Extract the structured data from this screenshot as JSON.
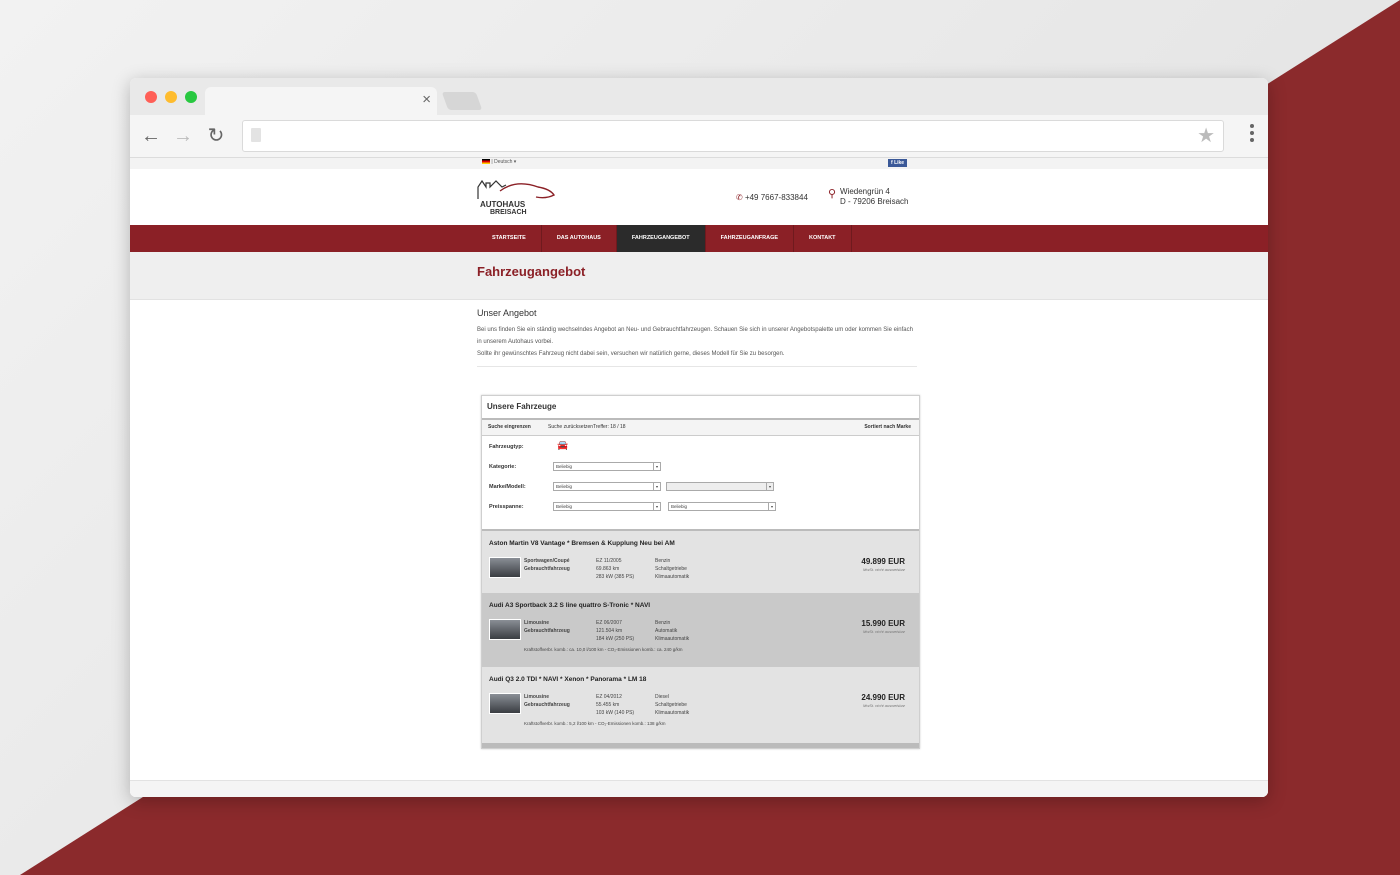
{
  "colors": {
    "brand": "#8b2026",
    "window_red": "#ff5f57",
    "window_yellow": "#febc2e",
    "window_green": "#28c840"
  },
  "browser": {
    "tab_close": "×",
    "back": "←",
    "forward": "→",
    "reload": "↻",
    "star": "★"
  },
  "site": {
    "language": "Deutsch",
    "facebook_like": "Like",
    "logo_text_1": "AUTOHAUS",
    "logo_text_2": "BREISACH",
    "phone": "+49 7667-833844",
    "address_line1": "Wiedengrün 4",
    "address_line2": "D - 79206 Breisach",
    "nav": [
      "STARTSEITE",
      "DAS AUTOHAUS",
      "FAHRZEUGANGEBOT",
      "FAHRZEUGANFRAGE",
      "KONTAKT"
    ],
    "page_title": "Fahrzeugangebot",
    "intro_heading": "Unser Angebot",
    "intro_p1": "Bei uns finden Sie ein ständig wechselndes Angebot an Neu- und Gebrauchtfahrzeugen. Schauen Sie sich in unserer Angebotspalette um oder kommen Sie einfach in unserem Autohaus vorbei.",
    "intro_p2": "Sollte ihr gewünschtes Fahrzeug nicht dabei sein, versuchen wir natürlich gerne, dieses Modell für Sie zu besorgen."
  },
  "widget": {
    "title": "Unsere Fahrzeuge",
    "bar_left": "Suche eingrenzen",
    "bar_mid": "Suche zurücksetzenTreffer: 18 / 18",
    "bar_right": "Sortiert nach Marke",
    "filter_type": "Fahrzeugtyp:",
    "filter_category": "Kategorie:",
    "filter_make": "Marke/Modell:",
    "filter_price": "Preisspanne:",
    "select_any": "Beliebig",
    "select_arrow": "▾"
  },
  "cars": [
    {
      "title": "Aston Martin V8 Vantage * Bremsen & Kupplung Neu bei AM",
      "body": "Sportwagen/Coupé",
      "state": "Gebrauchtfahrzeug",
      "ez": "EZ 11/2005",
      "km": "69.863 km",
      "power": "283 kW (385 PS)",
      "fuel": "Benzin",
      "gear": "Schaltgetriebe",
      "ac": "Klimaautomatik",
      "price": "49.899 EUR",
      "vat": "MwSt. nicht ausweisbar",
      "consumption": ""
    },
    {
      "title": "Audi A3 Sportback 3.2 S line quattro S-Tronic * NAVI",
      "body": "Limousine",
      "state": "Gebrauchtfahrzeug",
      "ez": "EZ 06/2007",
      "km": "121.504 km",
      "power": "184 kW (250 PS)",
      "fuel": "Benzin",
      "gear": "Automatik",
      "ac": "Klimaautomatik",
      "price": "15.990 EUR",
      "vat": "MwSt. nicht ausweisbar",
      "consumption": "Kraftstoffverbr. komb.: ca. 10,0 l/100 km - CO₂-Emissionen komb.: ca. 240 g/km"
    },
    {
      "title": "Audi Q3 2.0 TDI * NAVI * Xenon * Panorama * LM 18",
      "body": "Limousine",
      "state": "Gebrauchtfahrzeug",
      "ez": "EZ 04/2012",
      "km": "55.455 km",
      "power": "103 kW (140 PS)",
      "fuel": "Diesel",
      "gear": "Schaltgetriebe",
      "ac": "Klimaautomatik",
      "price": "24.990 EUR",
      "vat": "MwSt. nicht ausweisbar",
      "consumption": "Kraftstoffverbr. komb.: 5,2 l/100 km - CO₂-Emissionen komb.: 138 g/km"
    }
  ]
}
